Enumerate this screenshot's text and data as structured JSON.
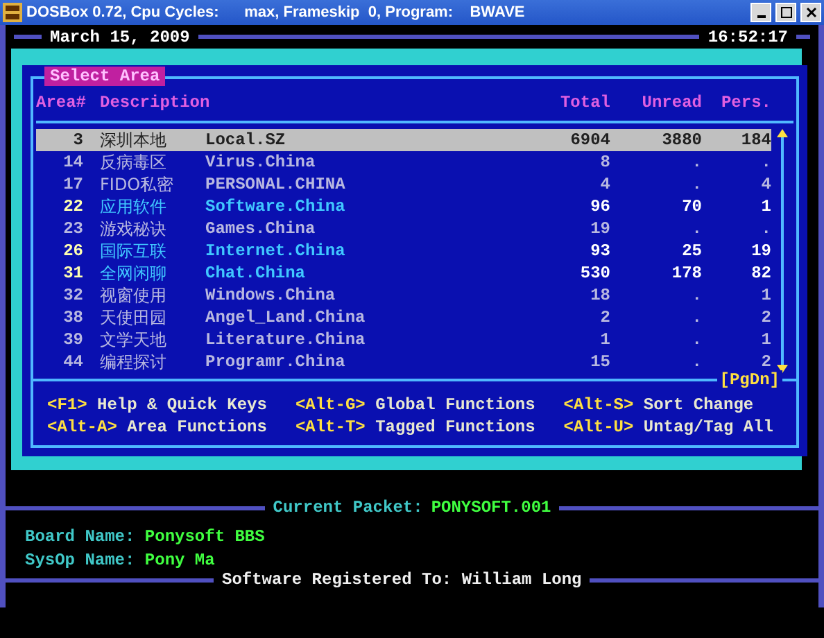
{
  "window": {
    "title": "DOSBox 0.72, Cpu Cycles:      max, Frameskip  0, Program:    BWAVE"
  },
  "header": {
    "date": "March 15, 2009",
    "time": "16:52:17"
  },
  "panel": {
    "title": "Select Area",
    "columns": [
      "Area#",
      "Description",
      "Total",
      "Unread",
      "Pers."
    ],
    "rows": [
      {
        "area": "3",
        "chinese": "深圳本地",
        "name": "Local.SZ",
        "total": "6904",
        "unread": "3880",
        "pers": "184",
        "selected": true,
        "new": false
      },
      {
        "area": "14",
        "chinese": "反病毒区",
        "name": "Virus.China",
        "total": "8",
        "unread": ".",
        "pers": ".",
        "selected": false,
        "new": false
      },
      {
        "area": "17",
        "chinese": "FIDO私密",
        "name": "PERSONAL.CHINA",
        "total": "4",
        "unread": ".",
        "pers": "4",
        "selected": false,
        "new": false
      },
      {
        "area": "22",
        "chinese": "应用软件",
        "name": "Software.China",
        "total": "96",
        "unread": "70",
        "pers": "1",
        "selected": false,
        "new": true
      },
      {
        "area": "23",
        "chinese": "游戏秘诀",
        "name": "Games.China",
        "total": "19",
        "unread": ".",
        "pers": ".",
        "selected": false,
        "new": false
      },
      {
        "area": "26",
        "chinese": "国际互联",
        "name": "Internet.China",
        "total": "93",
        "unread": "25",
        "pers": "19",
        "selected": false,
        "new": true
      },
      {
        "area": "31",
        "chinese": "全网闲聊",
        "name": "Chat.China",
        "total": "530",
        "unread": "178",
        "pers": "82",
        "selected": false,
        "new": true
      },
      {
        "area": "32",
        "chinese": "视窗使用",
        "name": "Windows.China",
        "total": "18",
        "unread": ".",
        "pers": "1",
        "selected": false,
        "new": false
      },
      {
        "area": "38",
        "chinese": "天使田园",
        "name": "Angel_Land.China",
        "total": "2",
        "unread": ".",
        "pers": "2",
        "selected": false,
        "new": false
      },
      {
        "area": "39",
        "chinese": "文学天地",
        "name": "Literature.China",
        "total": "1",
        "unread": ".",
        "pers": "1",
        "selected": false,
        "new": false
      },
      {
        "area": "44",
        "chinese": "编程探讨",
        "name": "Programr.China",
        "total": "15",
        "unread": ".",
        "pers": "2",
        "selected": false,
        "new": false
      }
    ],
    "page_hint": "[PgDn]",
    "shortcuts": [
      {
        "key": "<F1>",
        "label": "Help & Quick Keys"
      },
      {
        "key": "<Alt-G>",
        "label": "Global Functions"
      },
      {
        "key": "<Alt-S>",
        "label": "Sort Change"
      },
      {
        "key": "<Alt-A>",
        "label": "Area Functions"
      },
      {
        "key": "<Alt-T>",
        "label": "Tagged Functions"
      },
      {
        "key": "<Alt-U>",
        "label": "Untag/Tag All"
      }
    ]
  },
  "packet": {
    "label": "Current Packet:",
    "value": "PONYSOFT.001"
  },
  "info": [
    {
      "label": "Board Name:",
      "value": "Ponysoft BBS"
    },
    {
      "label": "SysOp Name:",
      "value": "Pony Ma"
    }
  ],
  "registration": "Software Registered To: William Long"
}
